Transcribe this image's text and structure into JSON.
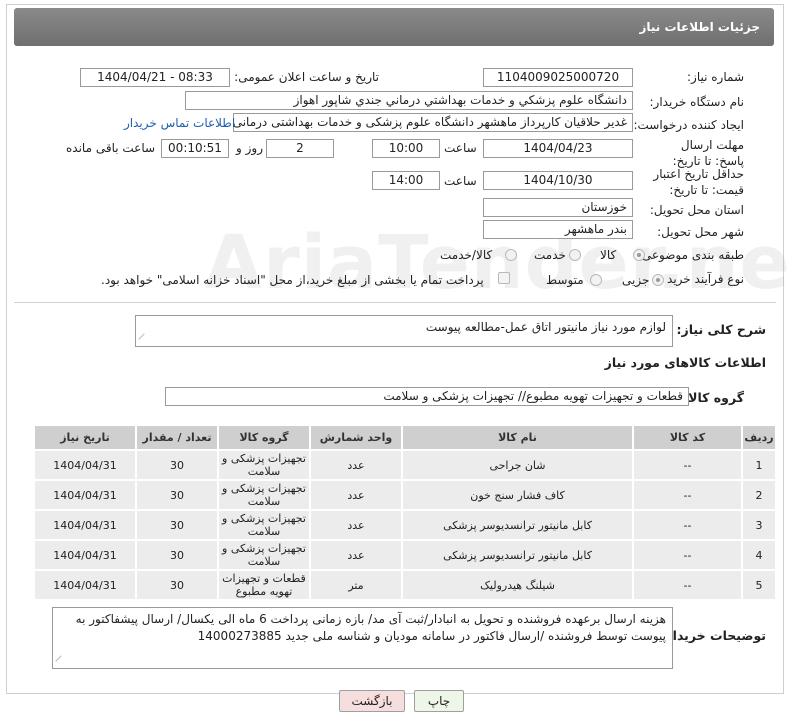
{
  "header": {
    "title": "جزئیات اطلاعات نیاز"
  },
  "fields": {
    "need_number": {
      "label": "شماره نیاز:",
      "value": "1104009025000720"
    },
    "announce_date": {
      "label": "تاریخ و ساعت اعلان عمومی:",
      "value": "1404/04/21 - 08:33"
    },
    "buyer_org": {
      "label": "نام دستگاه خریدار:",
      "value": "دانشگاه علوم پزشكي و خدمات بهداشتي درماني جندي شاپور اهواز"
    },
    "requester": {
      "label": "ایجاد کننده درخواست:",
      "value": "غدیر حلاقیان کارپرداز ماهشهر دانشگاه علوم پزشکی و خدمات بهداشتی درمانی",
      "contact_link": "اطلاعات تماس خریدار"
    },
    "response_deadline": {
      "label": "مهلت ارسال پاسخ: تا تاریخ:",
      "date": "1404/04/23",
      "time_label": "ساعت",
      "time": "10:00",
      "days": "2",
      "days_label": "روز و",
      "remaining": "00:10:51",
      "remaining_label": "ساعت باقی مانده"
    },
    "price_validity": {
      "label": "حداقل تاریخ اعتبار قیمت: تا تاریخ:",
      "date": "1404/10/30",
      "time_label": "ساعت",
      "time": "14:00"
    },
    "province": {
      "label": "استان محل تحویل:",
      "value": "خوزستان"
    },
    "city": {
      "label": "شهر محل تحویل:",
      "value": "بندر ماهشهر"
    },
    "category": {
      "label": "طبقه بندی موضوعی:",
      "options": [
        "کالا",
        "خدمت",
        "کالا/خدمت"
      ],
      "selected": "کالا"
    },
    "purchase_type": {
      "label": "نوع فرآیند خرید :",
      "options": [
        "جزیی",
        "متوسط"
      ],
      "selected": "جزیی",
      "note": "پرداخت تمام یا بخشی از مبلغ خرید،از محل \"اسناد خزانه اسلامی\" خواهد بود."
    }
  },
  "need_summary": {
    "label": "شرح کلی نیاز:",
    "value": "لوازم مورد نیاز مانیتور اتاق عمل-مطالعه پیوست"
  },
  "items_section": {
    "title": "اطلاعات کالاهای مورد نیاز",
    "group_label": "گروه کالا:",
    "group_value": "قطعات و تجهیزات تهویه مطبوع// تجهیزات پزشکی و سلامت"
  },
  "table": {
    "headers": [
      "ردیف",
      "کد کالا",
      "نام کالا",
      "واحد شمارش",
      "گروه کالا",
      "تعداد / مقدار",
      "تاریخ نیاز"
    ],
    "rows": [
      [
        "1",
        "--",
        "شان جراحی",
        "عدد",
        "تجهیزات پزشکی و سلامت",
        "30",
        "1404/04/31"
      ],
      [
        "2",
        "--",
        "کاف فشار سنج خون",
        "عدد",
        "تجهیزات پزشکی و سلامت",
        "30",
        "1404/04/31"
      ],
      [
        "3",
        "--",
        "کابل مانیتور ترانسدیوسر پزشکی",
        "عدد",
        "تجهیزات پزشکی و سلامت",
        "30",
        "1404/04/31"
      ],
      [
        "4",
        "--",
        "کابل مانیتور ترانسدیوسر پزشکی",
        "عدد",
        "تجهیزات پزشکی و سلامت",
        "30",
        "1404/04/31"
      ],
      [
        "5",
        "--",
        "شیلنگ هیدرولیک",
        "متر",
        "قطعات و تجهیزات تهویه مطبوع",
        "30",
        "1404/04/31"
      ]
    ]
  },
  "buyer_notes": {
    "label": "توضیحات خریدار:",
    "value": "هزینه ارسال برعهده فروشنده و تحویل به انبادار/ثبت آی مد/ بازه زمانی پرداخت 6 ماه الی یکسال/ ارسال پیشفاکتور به پیوست توسط فروشنده /ارسال فاکتور در سامانه مودیان و شناسه ملی جدید  14000273885"
  },
  "buttons": {
    "print": "چاپ",
    "back": "بازگشت"
  },
  "watermark": "AriaTender.net"
}
